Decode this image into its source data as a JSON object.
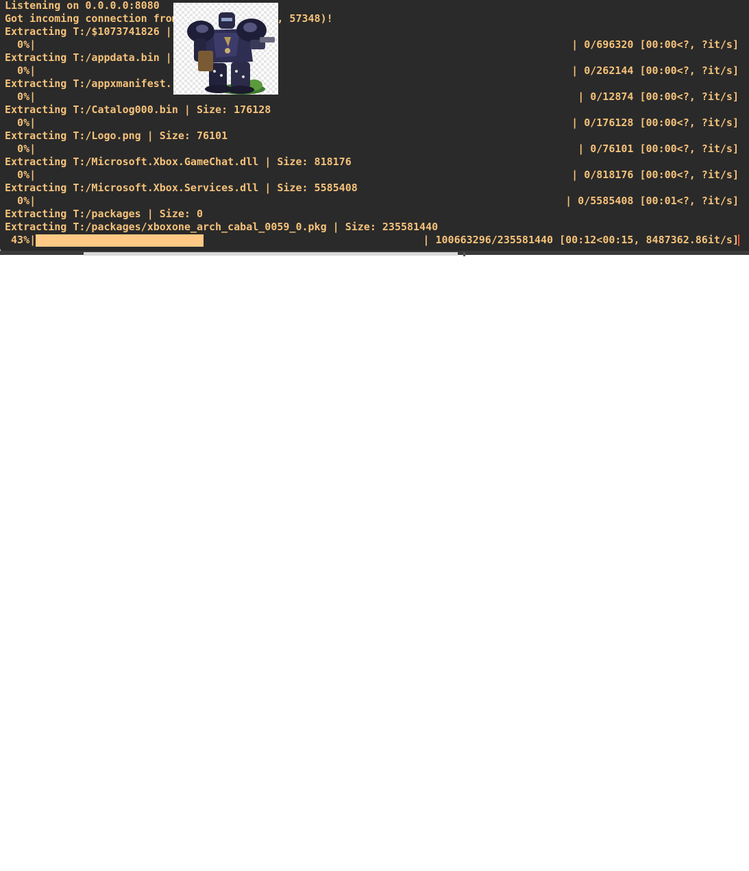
{
  "terminal": {
    "lines": [
      {
        "text": "Listening on 0.0.0.0:8080"
      },
      {
        "text": "Got incoming connection from                , 57348)!"
      },
      {
        "text": "Extracting T:/$1073741826 |"
      },
      {
        "pct": "  0%|",
        "stats": "| 0/696320 [00:00<?, ?it/s]",
        "progress": 0.0
      },
      {
        "text": "Extracting T:/appdata.bin |"
      },
      {
        "pct": "  0%|",
        "stats": "| 0/262144 [00:00<?, ?it/s]",
        "progress": 0.0
      },
      {
        "text": "Extracting T:/appxmanifest.:"
      },
      {
        "pct": "  0%|",
        "stats": "| 0/12874 [00:00<?, ?it/s]",
        "progress": 0.0
      },
      {
        "text": "Extracting T:/Catalog000.bin | Size: 176128"
      },
      {
        "pct": "  0%|",
        "stats": "| 0/176128 [00:00<?, ?it/s]",
        "progress": 0.0
      },
      {
        "text": "Extracting T:/Logo.png | Size: 76101"
      },
      {
        "pct": "  0%|",
        "stats": "| 0/76101 [00:00<?, ?it/s]",
        "progress": 0.0
      },
      {
        "text": "Extracting T:/Microsoft.Xbox.GameChat.dll | Size: 818176"
      },
      {
        "pct": "  0%|",
        "stats": "| 0/818176 [00:00<?, ?it/s]",
        "progress": 0.0
      },
      {
        "text": "Extracting T:/Microsoft.Xbox.Services.dll | Size: 5585408"
      },
      {
        "pct": "  0%|",
        "stats": "| 0/5585408 [00:01<?, ?it/s]",
        "progress": 0.0
      },
      {
        "text": "Extracting T:/packages | Size: 0"
      },
      {
        "text": "Extracting T:/packages/xboxone_arch_cabal_0059_0.pkg | Size: 235581440"
      },
      {
        "pct": " 43%|",
        "stats": "| 100663296/235581440 [00:12<00:15, 8487362.86it/s]",
        "progress": 0.43
      }
    ]
  },
  "avatar": {
    "icon": "armored-warrior-icon"
  },
  "colors": {
    "background": "#2a2a2a",
    "text": "#f5c27a",
    "bar": "#ffc985",
    "cursor": "#e8533a"
  }
}
